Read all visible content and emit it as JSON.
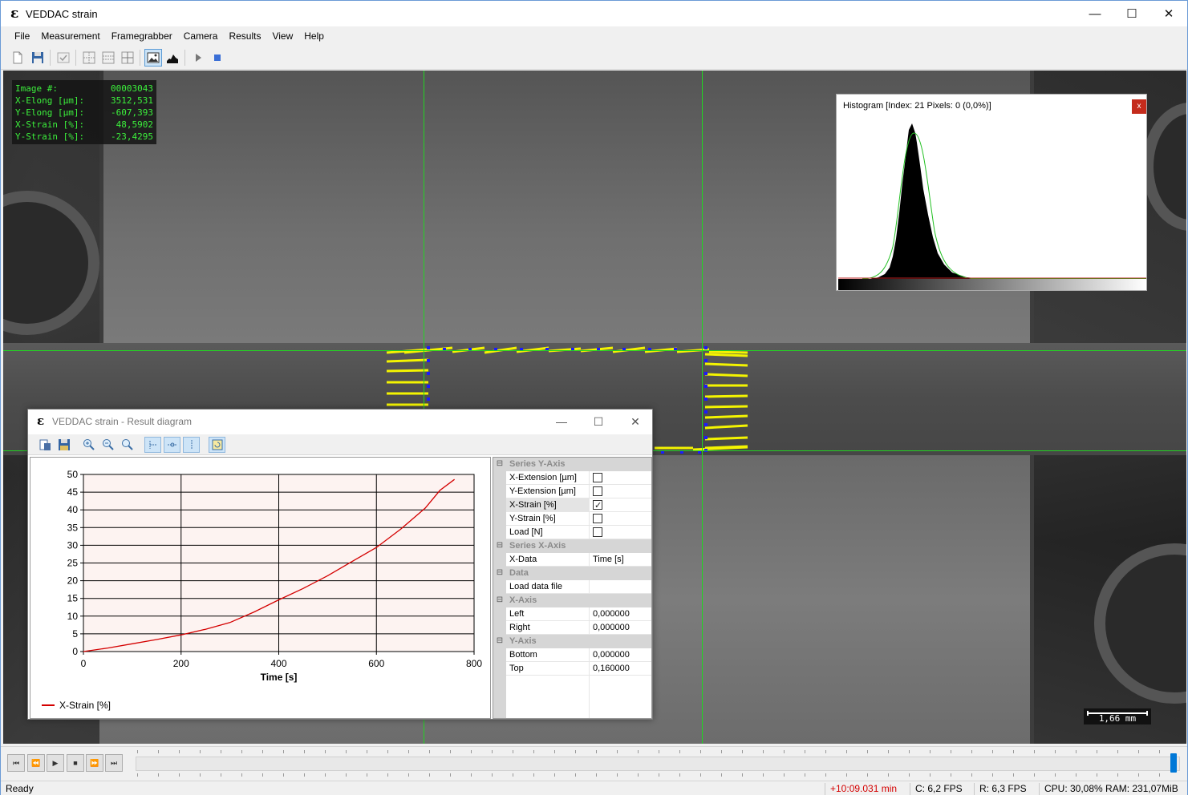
{
  "window": {
    "app_logo": "ε",
    "title": "VEDDAC strain",
    "minimize": "—",
    "maximize": "☐",
    "close": "✕"
  },
  "menu": [
    "File",
    "Measurement",
    "Framegrabber",
    "Camera",
    "Results",
    "View",
    "Help"
  ],
  "toolbar": {
    "buttons": [
      "new-icon",
      "save-icon",
      "check-icon",
      "grid-vertical-icon",
      "grid-horizontal-icon",
      "grid-both-icon",
      "image-icon",
      "histogram-icon",
      "play-icon",
      "stop-icon"
    ],
    "active": [
      "image-icon"
    ]
  },
  "overlay": {
    "rows": [
      {
        "label": "Image #:",
        "value": "00003043"
      },
      {
        "label": "X-Elong [µm]:",
        "value": "3512,531"
      },
      {
        "label": "Y-Elong [µm]:",
        "value": "-607,393"
      },
      {
        "label": "X-Strain [%]:",
        "value": "48,5902"
      },
      {
        "label": "Y-Strain [%]:",
        "value": "-23,4295"
      }
    ]
  },
  "scale_bar": {
    "label": "1,66 mm"
  },
  "histogram": {
    "title": "Histogram [Index: 21 Pixels: 0 (0,0%)]",
    "close": "x",
    "fit_color": "#22c022",
    "bar_color": "#000000"
  },
  "result_diagram": {
    "logo": "ε",
    "title": "VEDDAC strain - Result diagram",
    "minimize": "—",
    "maximize": "☐",
    "close": "✕",
    "toolbar": [
      "export-icon",
      "save-diagram-icon",
      "zoom-in-icon",
      "zoom-out-icon",
      "zoom-fit-icon",
      "pan-x-icon",
      "pan-xy-icon",
      "pan-y-icon",
      "refresh-icon"
    ],
    "toolbar_active": [
      "pan-x-icon",
      "pan-xy-icon",
      "pan-y-icon",
      "refresh-icon"
    ],
    "legend": "X-Strain [%]",
    "properties": [
      {
        "type": "category",
        "label": "Series Y-Axis"
      },
      {
        "type": "check",
        "label": "X-Extension [µm]",
        "checked": false
      },
      {
        "type": "check",
        "label": "Y-Extension [µm]",
        "checked": false
      },
      {
        "type": "check",
        "label": "X-Strain [%]",
        "checked": true
      },
      {
        "type": "check",
        "label": "Y-Strain [%]",
        "checked": false
      },
      {
        "type": "check",
        "label": "Load [N]",
        "checked": false
      },
      {
        "type": "category",
        "label": "Series X-Axis"
      },
      {
        "type": "value",
        "label": "X-Data",
        "value": "Time [s]"
      },
      {
        "type": "category",
        "label": "Data"
      },
      {
        "type": "value",
        "label": "Load data file",
        "value": ""
      },
      {
        "type": "category",
        "label": "X-Axis"
      },
      {
        "type": "value",
        "label": "Left",
        "value": "0,000000"
      },
      {
        "type": "value",
        "label": "Right",
        "value": "0,000000"
      },
      {
        "type": "category",
        "label": "Y-Axis"
      },
      {
        "type": "value",
        "label": "Bottom",
        "value": "0,000000"
      },
      {
        "type": "value",
        "label": "Top",
        "value": "0,160000"
      }
    ]
  },
  "chart_data": {
    "type": "line",
    "xlabel": "Time [s]",
    "ylabel": "",
    "xlim": [
      0,
      800
    ],
    "ylim": [
      0,
      50
    ],
    "xticks": [
      0,
      200,
      400,
      600,
      800
    ],
    "yticks": [
      0,
      5,
      10,
      15,
      20,
      25,
      30,
      35,
      40,
      45,
      50
    ],
    "grid": true,
    "legend_position": "bottom-left",
    "series": [
      {
        "name": "X-Strain [%]",
        "color": "#d40000",
        "x": [
          0,
          50,
          100,
          150,
          200,
          250,
          300,
          350,
          400,
          450,
          500,
          550,
          600,
          650,
          700,
          730,
          760
        ],
        "y": [
          0,
          1.0,
          2.2,
          3.4,
          4.7,
          6.3,
          8.2,
          11.2,
          14.6,
          17.8,
          21.4,
          25.4,
          29.4,
          34.6,
          40.5,
          45.5,
          48.6
        ]
      }
    ]
  },
  "playback": {
    "buttons": [
      "skip-start-icon",
      "step-back-icon",
      "play-icon",
      "stop-icon",
      "step-forward-icon",
      "skip-end-icon"
    ],
    "position": 0.995
  },
  "status": {
    "ready": "Ready",
    "time": "+10:09.031 min",
    "time_color": "#d40000",
    "camera_fps": "C: 6,2 FPS",
    "record_fps": "R: 6,3 FPS",
    "resources": "CPU: 30,08% RAM: 231,07MiB"
  }
}
